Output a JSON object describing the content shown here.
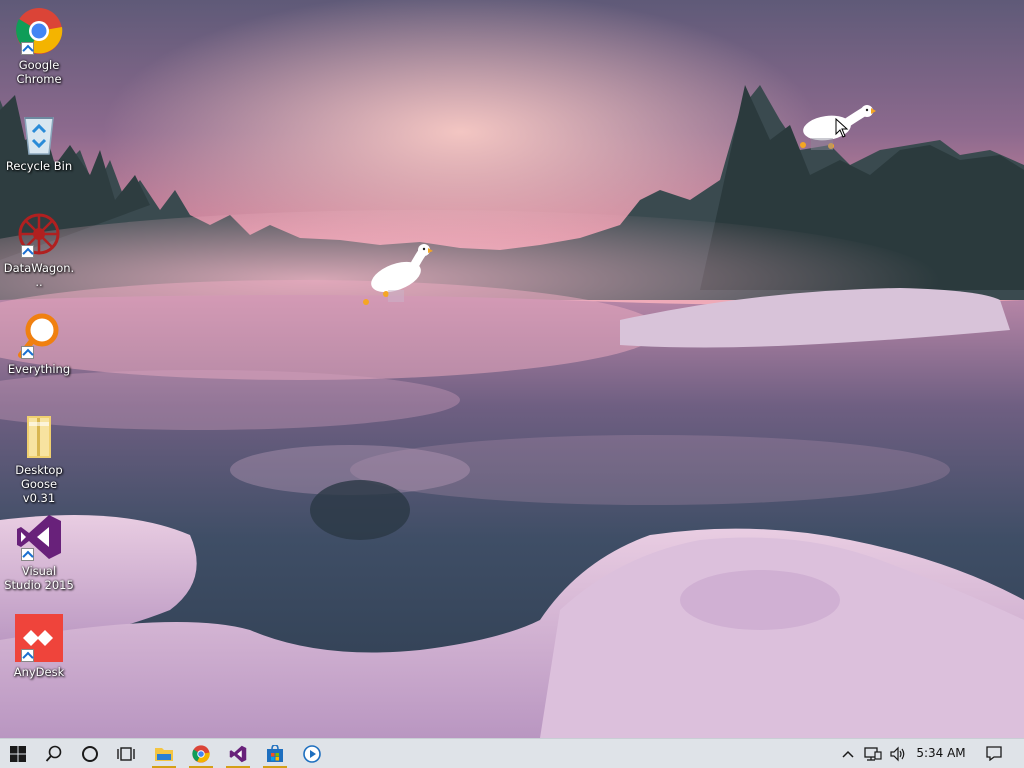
{
  "desktop": {
    "icons": [
      {
        "label": "Google Chrome",
        "icon": "chrome-icon"
      },
      {
        "label": "Recycle Bin",
        "icon": "recycle-bin-icon"
      },
      {
        "label": "DataWagon...",
        "icon": "datawagon-icon"
      },
      {
        "label": "Everything",
        "icon": "everything-search-icon"
      },
      {
        "label": "Desktop Goose v0.31",
        "icon": "folder-icon"
      },
      {
        "label": "Visual Studio 2015",
        "icon": "visual-studio-icon"
      },
      {
        "label": "AnyDesk",
        "icon": "anydesk-icon"
      }
    ]
  },
  "taskbar": {
    "apps": [
      "start-icon",
      "search-icon",
      "cortana-icon",
      "task-view-icon",
      "file-explorer-icon",
      "chrome-icon",
      "visual-studio-icon",
      "store-icon",
      "media-player-icon"
    ],
    "active_apps": [
      "file-explorer-icon",
      "chrome-icon",
      "visual-studio-icon",
      "store-icon"
    ],
    "accent": "#d4a017",
    "clock": "5:34 AM"
  }
}
